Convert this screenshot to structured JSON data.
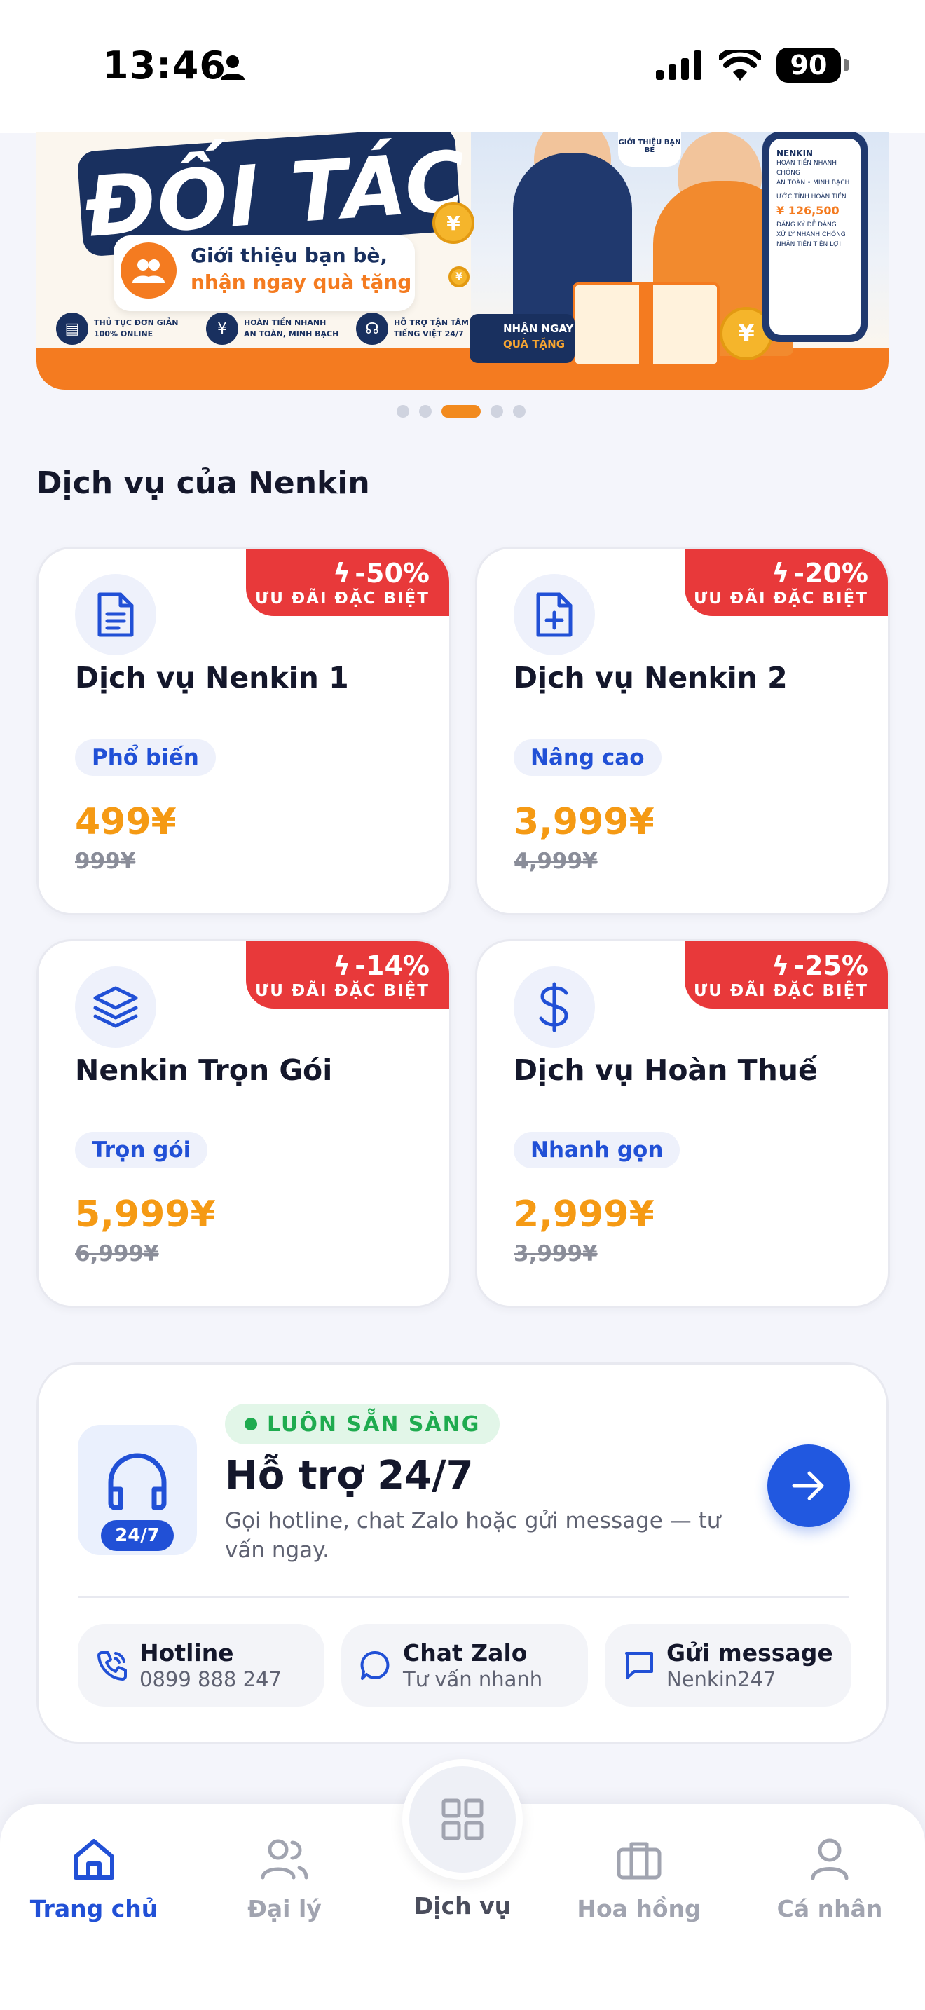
{
  "status_bar": {
    "time": "13:46",
    "battery": "90"
  },
  "banner": {
    "title": "ĐỐI TÁC",
    "subtitle_line1": "Giới thiệu bạn bè,",
    "subtitle_line2": "nhận ngay quà tặng",
    "features": [
      {
        "line1": "THỦ TỤC ĐƠN GIẢN",
        "line2": "100% ONLINE"
      },
      {
        "line1": "HOÀN TIỀN NHANH",
        "line2": "AN TOÀN, MINH BẠCH"
      },
      {
        "line1": "HỖ TRỢ TẬN TÂM",
        "line2": "TIẾNG VIỆT 24/7"
      }
    ],
    "gift_badge_line1": "NHẬN NGAY",
    "gift_badge_line2": "QUÀ TẶNG",
    "bubble_text": "GIỚI THIỆU BẠN BÈ",
    "phone_brand": "NENKIN",
    "phone_line1": "HOÀN TIỀN NHANH CHÓNG",
    "phone_line2": "AN TOÀN • MINH BẠCH",
    "phone_estimate_label": "ƯỚC TÍNH HOÀN TIỀN",
    "phone_amount": "¥ 126,500",
    "phone_step1": "ĐĂNG KÝ DỄ DÀNG",
    "phone_step2": "XỬ LÝ NHANH CHÓNG",
    "phone_step3": "NHẬN TIỀN TIỆN LỢI",
    "active_slide": 3,
    "total_slides": 5
  },
  "section_title": "Dịch vụ của Nenkin",
  "services": [
    {
      "title": "Dịch vụ Nenkin 1",
      "tag": "Phổ biến",
      "price": "499¥",
      "old_price": "999¥",
      "discount": "-50%",
      "badge_label": "ƯU ĐÃI ĐẶC BIỆT",
      "icon": "document-icon"
    },
    {
      "title": "Dịch vụ Nenkin 2",
      "tag": "Nâng cao",
      "price": "3,999¥",
      "old_price": "4,999¥",
      "discount": "-20%",
      "badge_label": "ƯU ĐÃI ĐẶC BIỆT",
      "icon": "file-plus-icon"
    },
    {
      "title": "Nenkin Trọn Gói",
      "tag": "Trọn gói",
      "price": "5,999¥",
      "old_price": "6,999¥",
      "discount": "-14%",
      "badge_label": "ƯU ĐÃI ĐẶC BIỆT",
      "icon": "layers-icon"
    },
    {
      "title": "Dịch vụ Hoàn Thuế",
      "tag": "Nhanh gọn",
      "price": "2,999¥",
      "old_price": "3,999¥",
      "discount": "-25%",
      "badge_label": "ƯU ĐÃI ĐẶC BIỆT",
      "icon": "dollar-icon"
    }
  ],
  "support": {
    "status": "LUÔN SẴN SÀNG",
    "title": "Hỗ trợ 24/7",
    "description": "Gọi hotline, chat Zalo hoặc gửi message — tư vấn ngay.",
    "icon_badge": "24/7",
    "contacts": [
      {
        "title": "Hotline",
        "subtitle": "0899 888 247"
      },
      {
        "title": "Chat Zalo",
        "subtitle": "Tư vấn nhanh"
      },
      {
        "title": "Gửi message",
        "subtitle": "Nenkin247"
      }
    ]
  },
  "bottom_nav": {
    "items": [
      {
        "label": "Trang chủ",
        "active": true
      },
      {
        "label": "Đại lý",
        "active": false
      },
      {
        "label": "Dịch vụ",
        "active": false
      },
      {
        "label": "Hoa hồng",
        "active": false
      },
      {
        "label": "Cá nhân",
        "active": false
      }
    ]
  },
  "colors": {
    "primary": "#2150d6",
    "accent_orange": "#f59a14",
    "discount_red": "#e8393a",
    "success_green": "#1fab4f",
    "background": "#f4f5fb"
  }
}
